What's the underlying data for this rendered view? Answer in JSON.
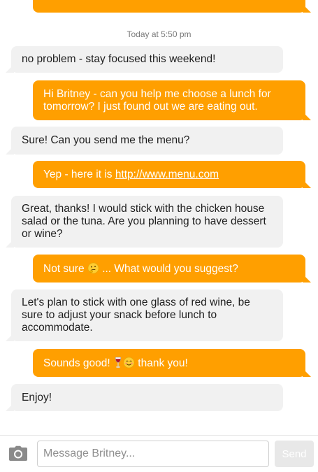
{
  "contact": {
    "name": "Britney"
  },
  "timestamp": "Today at 5:50 pm",
  "messages": [
    {
      "direction": "out",
      "text": ""
    },
    {
      "direction": "in",
      "text": "no problem - stay focused this weekend!"
    },
    {
      "direction": "out",
      "text": "Hi Britney - can you help me choose a lunch for tomorrow? I just found out we are eating out."
    },
    {
      "direction": "in",
      "text": "Sure! Can you send me the menu?"
    },
    {
      "direction": "out",
      "text_prefix": "Yep - here it is ",
      "link": "http://www.menu.com"
    },
    {
      "direction": "in",
      "text": "Great, thanks! I would stick with the chicken house salad or the tuna. Are you planning to have dessert or wine?"
    },
    {
      "direction": "out",
      "text_prefix": "Not sure ",
      "text_suffix": " ... What would you suggest?"
    },
    {
      "direction": "in",
      "text": "Let's plan to stick with one glass of red wine, be sure to adjust your snack before lunch to accommodate."
    },
    {
      "direction": "out",
      "text_prefix": "Sounds good! ",
      "text_suffix": " thank you!"
    },
    {
      "direction": "in",
      "text": "Enjoy!"
    }
  ],
  "composer": {
    "placeholder": "Message Britney...",
    "send_label": "Send",
    "camera_icon": "camera-icon"
  },
  "colors": {
    "outgoing_bubble": "#ff9f00",
    "incoming_bubble": "#f1f1f1",
    "timestamp_text": "#7a7a7a"
  }
}
